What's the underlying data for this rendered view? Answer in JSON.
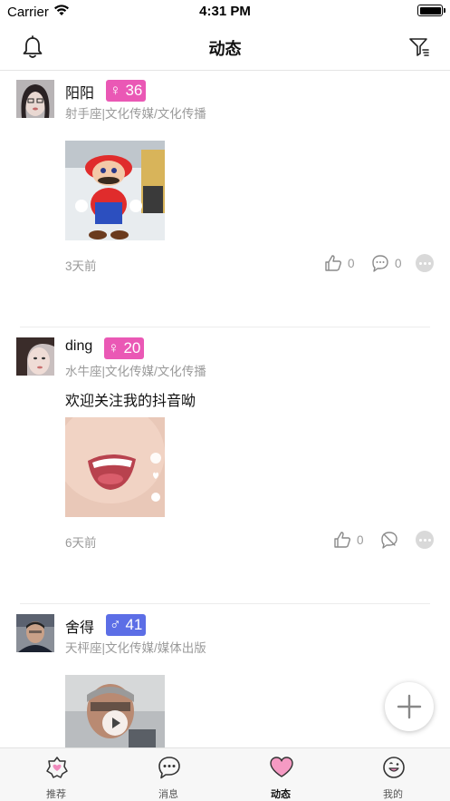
{
  "status_bar": {
    "carrier": "Carrier",
    "time": "4:31 PM"
  },
  "header": {
    "title": "动态"
  },
  "posts": [
    {
      "name": "阳阳",
      "badge": "♀ 36",
      "meta": "射手座|文化传媒/文化传播",
      "text": "",
      "time": "3天前",
      "likes": "0",
      "comments": "0"
    },
    {
      "name": "ding",
      "badge": "♀ 20",
      "meta": "水牛座|文化传媒/文化传播",
      "text": "欢迎关注我的抖音呦",
      "time": "6天前",
      "likes": "0",
      "comments": ""
    },
    {
      "name": "舍得",
      "badge": "♂ 41",
      "meta": "天枰座|文化传媒/媒体出版",
      "text": "",
      "time": "",
      "likes": "",
      "comments": ""
    }
  ],
  "tabs": [
    {
      "label": "推荐"
    },
    {
      "label": "消息"
    },
    {
      "label": "动态"
    },
    {
      "label": "我的"
    }
  ],
  "colors": {
    "female_badge": "#ea58b5",
    "male_badge": "#5c6ee6",
    "accent_pink": "#f08bbd"
  }
}
